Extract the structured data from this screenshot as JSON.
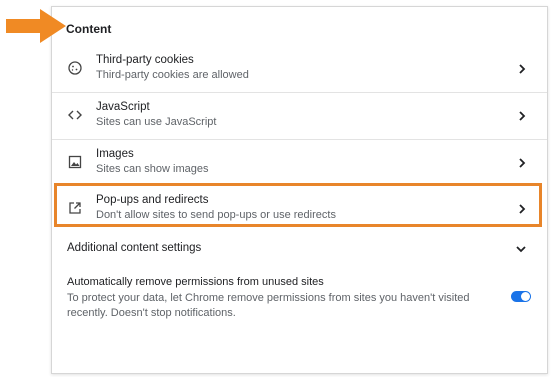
{
  "section": {
    "title": "Content"
  },
  "rows": [
    {
      "icon": "cookie-icon",
      "title": "Third-party cookies",
      "subtitle": "Third-party cookies are allowed"
    },
    {
      "icon": "code-icon",
      "title": "JavaScript",
      "subtitle": "Sites can use JavaScript"
    },
    {
      "icon": "image-icon",
      "title": "Images",
      "subtitle": "Sites can show images"
    },
    {
      "icon": "open-in-new-icon",
      "title": "Pop-ups and redirects",
      "subtitle": "Don't allow sites to send pop-ups or use redirects"
    }
  ],
  "additional": {
    "label": "Additional content settings"
  },
  "auto_remove": {
    "title": "Automatically remove permissions from unused sites",
    "description": "To protect your data, let Chrome remove permissions from sites you haven't visited recently. Doesn't stop notifications.",
    "enabled": true
  },
  "colors": {
    "highlight": "#e8852a",
    "accent": "#1a73e8",
    "arrow": "#f08a24"
  },
  "annotation": {
    "arrow_icon": "arrow-right-icon"
  }
}
